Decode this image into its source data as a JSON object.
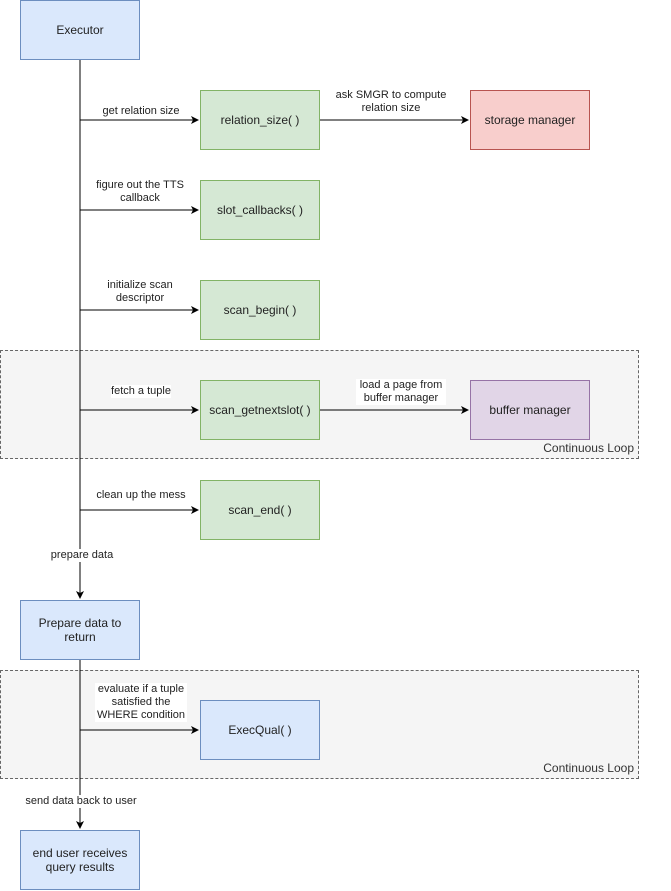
{
  "nodes": {
    "executor": "Executor",
    "relation_size": "relation_size( )",
    "storage_manager": "storage manager",
    "slot_callbacks": "slot_callbacks( )",
    "scan_begin": "scan_begin( )",
    "scan_getnextslot": "scan_getnextslot( )",
    "buffer_manager": "buffer manager",
    "scan_end": "scan_end( )",
    "prepare_data": "Prepare data to return",
    "execqual": "ExecQual( )",
    "end_user": "end user receives query results"
  },
  "edges": {
    "get_relation_size": "get relation size",
    "ask_smgr": "ask SMGR to compute relation size",
    "figure_out_tts": "figure out the TTS callback",
    "init_scan": "initialize scan descriptor",
    "fetch_tuple": "fetch a tuple",
    "load_page": "load a page from buffer manager",
    "clean_up": "clean up the mess",
    "prepare_data": "prepare data",
    "evaluate": "evaluate if a tuple satisfied the WHERE condition",
    "send_back": "send data back to user"
  },
  "groups": {
    "loop1": "Continuous Loop",
    "loop2": "Continuous Loop"
  },
  "colors": {
    "blue": "#dae8fc",
    "green": "#d5e8d4",
    "red": "#f8cecc",
    "purple": "#e1d5e7",
    "group": "#f5f5f5"
  }
}
